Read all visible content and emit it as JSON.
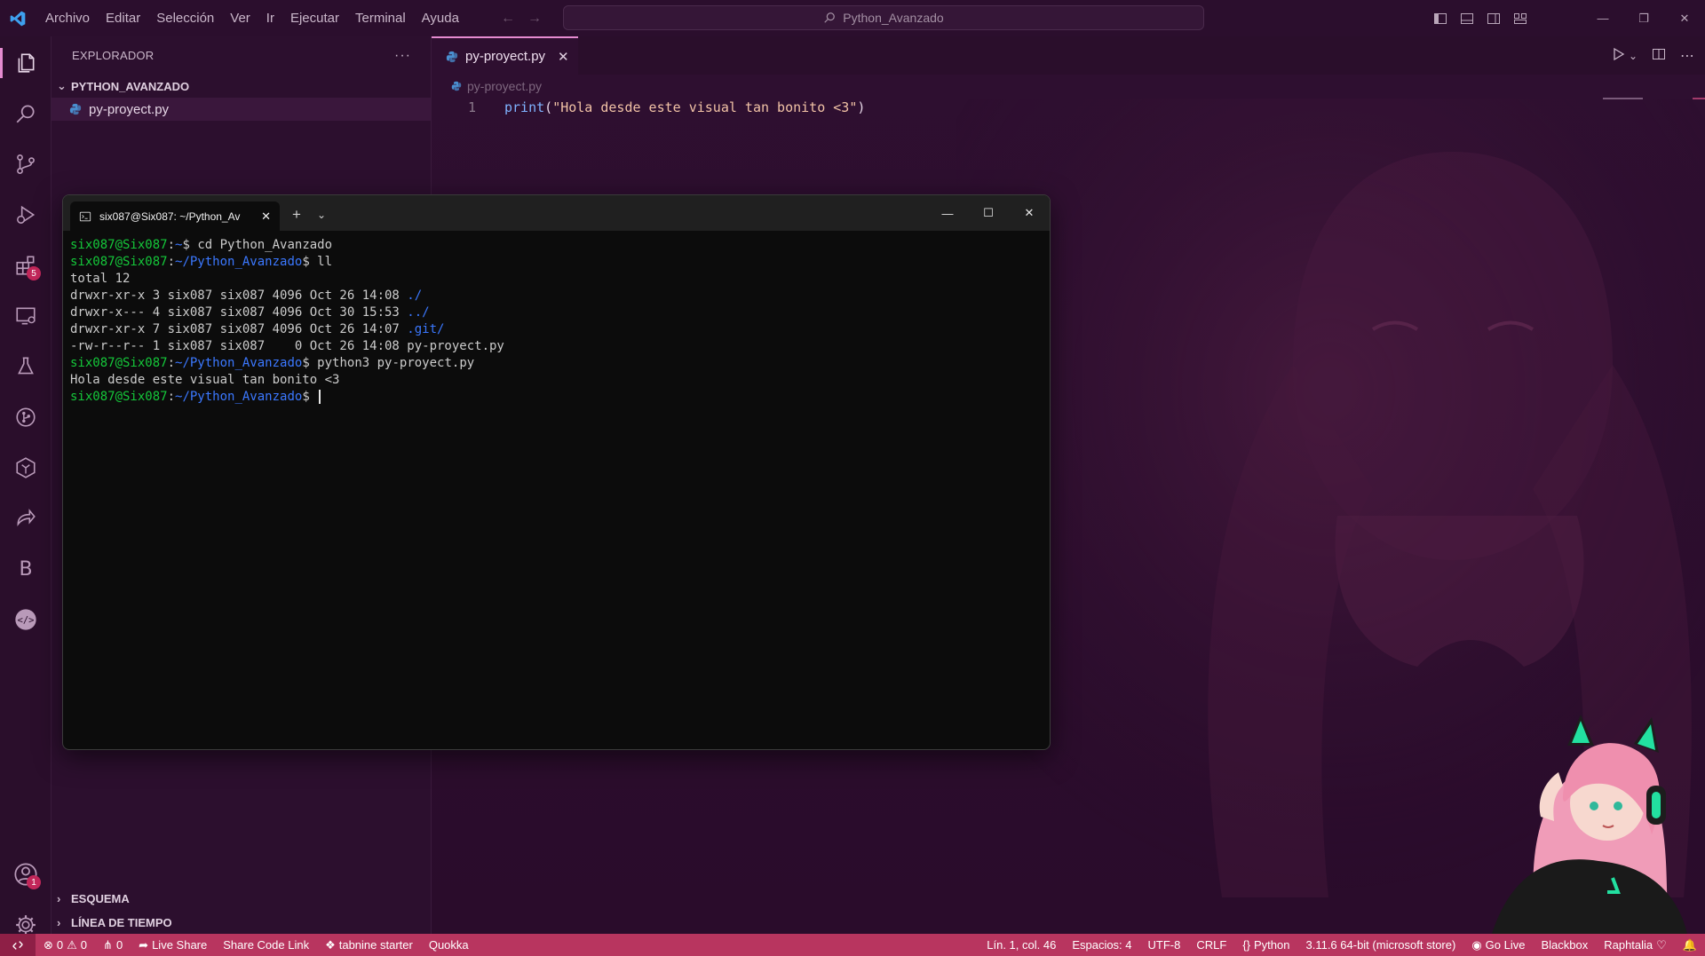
{
  "titlebar": {
    "menu": [
      "Archivo",
      "Editar",
      "Selección",
      "Ver",
      "Ir",
      "Ejecutar",
      "Terminal",
      "Ayuda"
    ],
    "search_text": "Python_Avanzado"
  },
  "activitybar": {
    "items": [
      "explorer",
      "search",
      "source-control",
      "run-debug",
      "extensions",
      "remote-explorer",
      "testing",
      "git-graph",
      "docker",
      "live-share",
      "blackbox",
      "codegpt"
    ],
    "extensions_badge": "5",
    "accounts_badge": "1"
  },
  "sidebar": {
    "title": "EXPLORADOR",
    "more": "···",
    "folder": "PYTHON_AVANZADO",
    "file": "py-proyect.py",
    "outline": "ESQUEMA",
    "timeline": "LÍNEA DE TIEMPO"
  },
  "editor": {
    "tab_label": "py-proyect.py",
    "breadcrumb": "py-proyect.py",
    "line_number": "1",
    "code_fn": "print",
    "code_open": "(",
    "code_str": "\"Hola desde este visual tan bonito <3\"",
    "code_close": ")"
  },
  "terminal": {
    "tab_title": "six087@Six087: ~/Python_Av",
    "lines": [
      {
        "user": "six087@Six087",
        "path": "~",
        "cmd": "cd Python_Avanzado"
      },
      {
        "user": "six087@Six087",
        "path": "~/Python_Avanzado",
        "cmd": "ll"
      },
      {
        "text": "total 12"
      },
      {
        "text": "drwxr-xr-x 3 six087 six087 4096 Oct 26 14:08 ",
        "dir": "./"
      },
      {
        "text": "drwxr-x--- 4 six087 six087 4096 Oct 30 15:53 ",
        "dir": "../"
      },
      {
        "text": "drwxr-xr-x 7 six087 six087 4096 Oct 26 14:07 ",
        "dir": ".git/"
      },
      {
        "text": "-rw-r--r-- 1 six087 six087    0 Oct 26 14:08 py-proyect.py"
      },
      {
        "user": "six087@Six087",
        "path": "~/Python_Avanzado",
        "cmd": "python3 py-proyect.py"
      },
      {
        "text": "Hola desde este visual tan bonito <3"
      },
      {
        "user": "six087@Six087",
        "path": "~/Python_Avanzado",
        "cmd": ""
      }
    ]
  },
  "statusbar": {
    "errors": "0",
    "warnings": "0",
    "ports": "0",
    "live_share": "Live Share",
    "share_code_link": "Share Code Link",
    "tabnine": "tabnine starter",
    "quokka": "Quokka",
    "cursor_pos": "Lín. 1, col. 46",
    "spaces": "Espacios: 4",
    "encoding": "UTF-8",
    "eol": "CRLF",
    "language": "Python",
    "interpreter": "3.11.6 64-bit (microsoft store)",
    "go_live": "Go Live",
    "blackbox": "Blackbox",
    "theme": "Raphtalia"
  },
  "colors": {
    "accent": "#e58bd0",
    "statusbar": "#b8355f",
    "editor_bg": "#2e0f30",
    "terminal_bg": "#0c0c0c",
    "prompt_green": "#15c73a",
    "prompt_blue": "#3b78ff"
  }
}
